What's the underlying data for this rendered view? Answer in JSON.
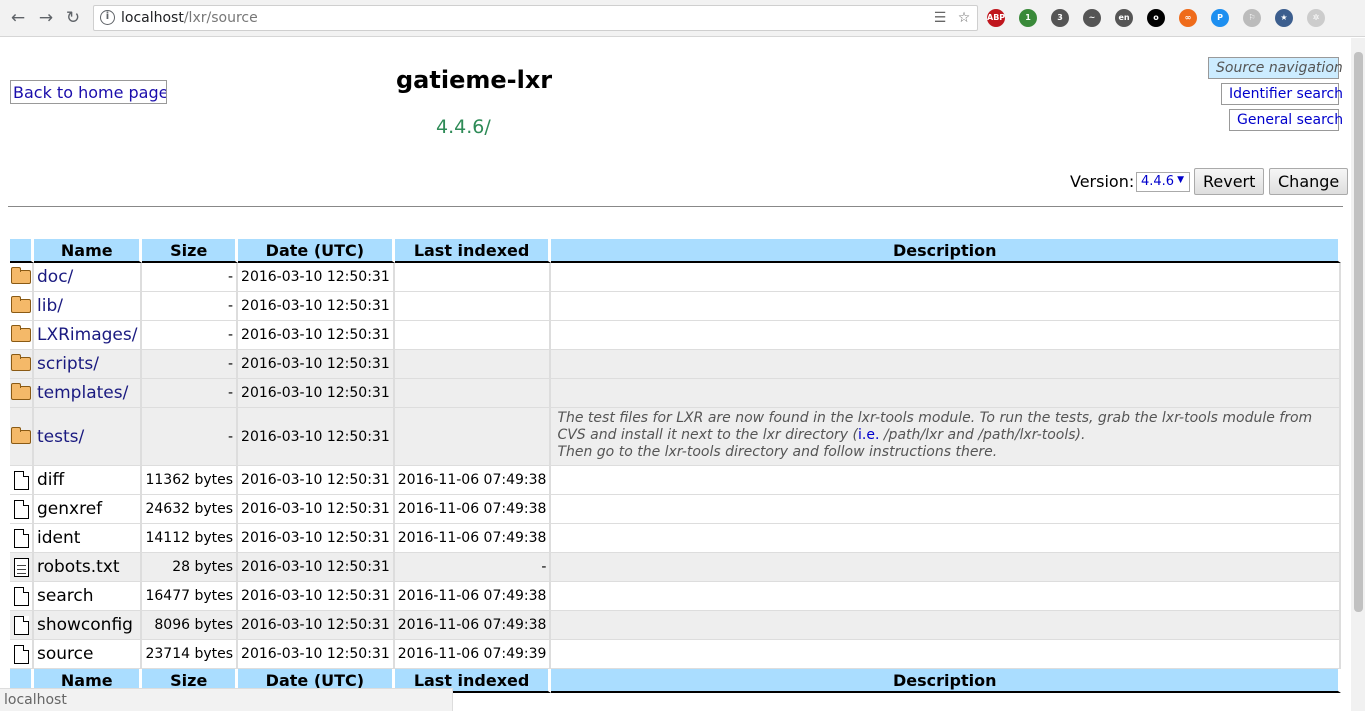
{
  "browser": {
    "url_host": "localhost",
    "url_path": "/lxr/source",
    "extensions": [
      {
        "name": "abp-icon",
        "label": "ABP",
        "color": "#c0161d"
      },
      {
        "name": "extension-badge-icon",
        "label": "1",
        "color": "#3a8a3a"
      },
      {
        "name": "bell-badge-icon",
        "label": "3",
        "color": "#555555"
      },
      {
        "name": "trend-icon",
        "label": "~",
        "color": "#555555"
      },
      {
        "name": "language-icon",
        "label": "en",
        "color": "#555555"
      },
      {
        "name": "circle-icon",
        "label": "o",
        "color": "#000000"
      },
      {
        "name": "infinity-icon",
        "label": "∞",
        "color": "#ef6b1a"
      },
      {
        "name": "magnifier-icon",
        "label": "P",
        "color": "#1d8ff0"
      },
      {
        "name": "dim-icon",
        "label": "⚐",
        "color": "#bbbbbb"
      },
      {
        "name": "star-circle-icon",
        "label": "★",
        "color": "#3c5e8e"
      },
      {
        "name": "grey-extension-icon",
        "label": "✲",
        "color": "#cccccc"
      }
    ]
  },
  "header": {
    "home_alt": "Back to home page",
    "site_title": "gatieme-lxr",
    "version_path": "4.4.6/"
  },
  "side_nav": {
    "source": "Source navigation",
    "identifier": "Identifier search",
    "general": "General search"
  },
  "version_form": {
    "label": "Version:",
    "selected": "4.4.6",
    "revert": "Revert",
    "change": "Change"
  },
  "table": {
    "headers": {
      "name": "Name",
      "size": "Size",
      "date": "Date (UTC)",
      "indexed": "Last indexed",
      "description": "Description"
    },
    "rows": [
      {
        "type": "folder",
        "name": "doc/",
        "size": "-",
        "date": "2016-03-10 12:50:31",
        "indexed": "",
        "description": ""
      },
      {
        "type": "folder",
        "name": "lib/",
        "size": "-",
        "date": "2016-03-10 12:50:31",
        "indexed": "",
        "description": ""
      },
      {
        "type": "folder",
        "name": "LXRimages/",
        "size": "-",
        "date": "2016-03-10 12:50:31",
        "indexed": "",
        "description": ""
      },
      {
        "type": "folder",
        "name": "scripts/",
        "size": "-",
        "date": "2016-03-10 12:50:31",
        "indexed": "",
        "description": ""
      },
      {
        "type": "folder",
        "name": "templates/",
        "size": "-",
        "date": "2016-03-10 12:50:31",
        "indexed": "",
        "description": ""
      },
      {
        "type": "folder",
        "name": "tests/",
        "size": "-",
        "date": "2016-03-10 12:50:31",
        "indexed": "",
        "description_pre": "The test files for LXR are now found in the lxr-tools module. To run the tests, grab the lxr-tools module from CVS and install it next to the lxr directory (",
        "description_ie": "i.e.",
        "description_post": " /path/lxr and /path/lxr-tools).",
        "description_line2": "Then go to the lxr-tools directory and follow instructions there."
      },
      {
        "type": "file",
        "name": "diff",
        "size": "11362 bytes",
        "date": "2016-03-10 12:50:31",
        "indexed": "2016-11-06 07:49:38",
        "description": ""
      },
      {
        "type": "file",
        "name": "genxref",
        "size": "24632 bytes",
        "date": "2016-03-10 12:50:31",
        "indexed": "2016-11-06 07:49:38",
        "description": ""
      },
      {
        "type": "file",
        "name": "ident",
        "size": "14112 bytes",
        "date": "2016-03-10 12:50:31",
        "indexed": "2016-11-06 07:49:38",
        "description": ""
      },
      {
        "type": "text",
        "name": "robots.txt",
        "size": "28 bytes",
        "date": "2016-03-10 12:50:31",
        "indexed": "-",
        "description": ""
      },
      {
        "type": "file",
        "name": "search",
        "size": "16477 bytes",
        "date": "2016-03-10 12:50:31",
        "indexed": "2016-11-06 07:49:38",
        "description": ""
      },
      {
        "type": "file",
        "name": "showconfig",
        "size": "8096 bytes",
        "date": "2016-03-10 12:50:31",
        "indexed": "2016-11-06 07:49:38",
        "description": ""
      },
      {
        "type": "file",
        "name": "source",
        "size": "23714 bytes",
        "date": "2016-03-10 12:50:31",
        "indexed": "2016-11-06 07:49:39",
        "description": ""
      }
    ]
  },
  "status_bar": "localhost"
}
